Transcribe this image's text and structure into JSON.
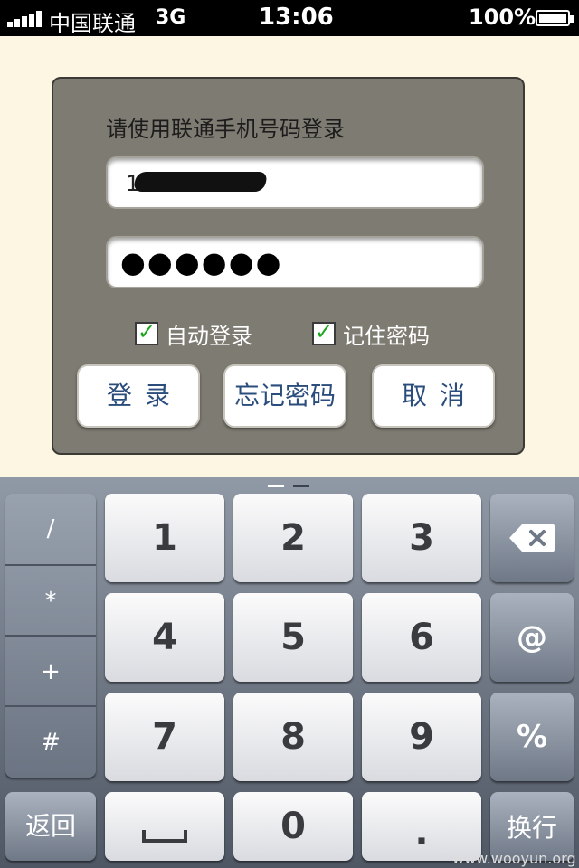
{
  "status_bar": {
    "carrier": "中国联通",
    "network": "3G",
    "time": "13:06",
    "battery_percent": "100%"
  },
  "login": {
    "title": "请使用联通手机号码登录",
    "phone_value": "1",
    "password_value": "●●●●●●",
    "auto_login": {
      "label": "自动登录",
      "checked": true
    },
    "remember_password": {
      "label": "记住密码",
      "checked": true
    },
    "buttons": {
      "login": "登录",
      "forgot": "忘记密码",
      "cancel": "取消"
    }
  },
  "keyboard": {
    "side_keys": [
      "/",
      "*",
      "+",
      "#"
    ],
    "digits": [
      "1",
      "2",
      "3",
      "4",
      "5",
      "6",
      "7",
      "8",
      "9",
      "0"
    ],
    "backspace_icon": "backspace-icon",
    "at_key": "@",
    "percent_key": "%",
    "back_key": "返回",
    "space_icon": "space-icon",
    "dot_key": ".",
    "return_key": "换行"
  },
  "watermark": "www.wooyun.org",
  "colors": {
    "panel": "#7e7b72",
    "background": "#fdf6e3",
    "button_text": "#2a4d7c",
    "check": "#1aa61a"
  }
}
